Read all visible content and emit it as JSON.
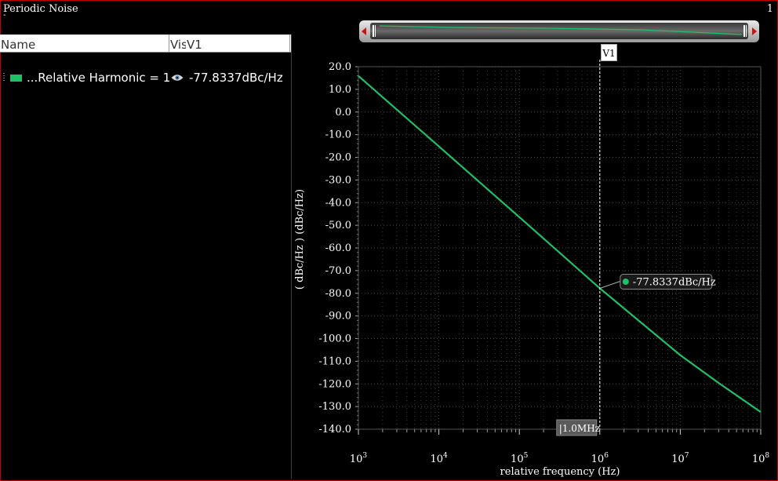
{
  "window": {
    "title": "Periodic Noise",
    "title_marker": "-",
    "page_number": "1"
  },
  "table": {
    "columns": [
      "Name",
      "Vis",
      "V1"
    ],
    "rows": [
      {
        "name": "...Relative Harmonic = 1",
        "color": "#1fc066",
        "visible_icon": "eye-icon",
        "v1": "-77.8337dBc/Hz"
      }
    ]
  },
  "marker": {
    "label": "V1",
    "x_label": "1.0MHz",
    "y_label": "-77.8337dBc/Hz",
    "x_value": 1000000,
    "y_value": -77.8337
  },
  "colors": {
    "trace": "#1fc066",
    "frame": "#c00000",
    "background": "#000000"
  },
  "chart_data": {
    "type": "line",
    "title": "",
    "xlabel": "relative frequency (Hz)",
    "ylabel": "( dBc/Hz ) (dBc/Hz)",
    "xscale": "log",
    "xlim": [
      1000,
      100000000
    ],
    "ylim": [
      -140,
      20
    ],
    "yticks": [
      "20.0",
      "10.0",
      "0.0",
      "-10.0",
      "-20.0",
      "-30.0",
      "-40.0",
      "-50.0",
      "-60.0",
      "-70.0",
      "-80.0",
      "-90.0",
      "-100.0",
      "-110.0",
      "-120.0",
      "-130.0",
      "-140.0"
    ],
    "xtick_exponents": [
      "3",
      "4",
      "5",
      "6",
      "7",
      "8"
    ],
    "xtick_base": "10",
    "grid": true,
    "series": [
      {
        "name": "...Relative Harmonic = 1",
        "x": [
          1000,
          10000,
          100000,
          1000000,
          10000000,
          30000000,
          100000000
        ],
        "y": [
          15.9,
          -15.2,
          -46.4,
          -77.8,
          -107.3,
          -119.6,
          -132.4
        ]
      }
    ]
  }
}
